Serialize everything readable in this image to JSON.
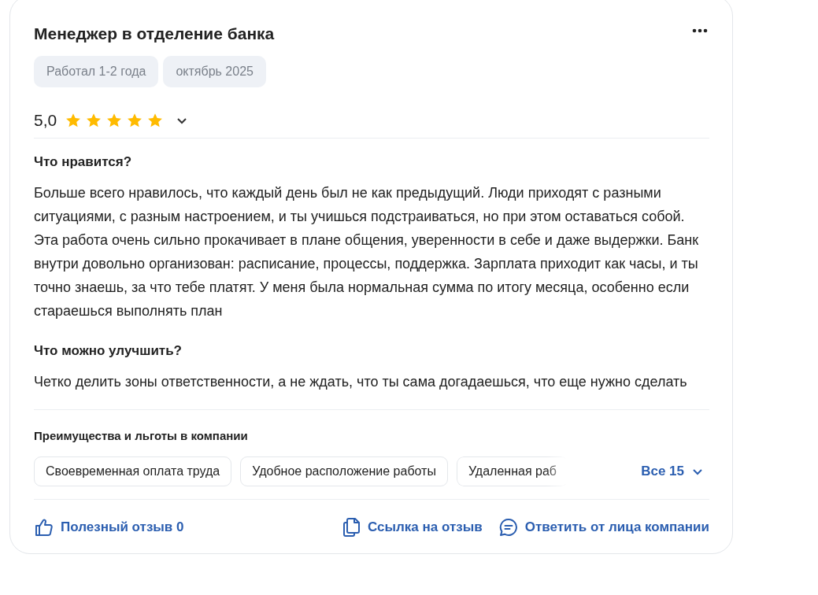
{
  "review": {
    "title": "Менеджер в отделение банка",
    "tags": [
      "Работал 1-2 года",
      "октябрь 2025"
    ],
    "rating": "5,0",
    "stars": 5,
    "sections": [
      {
        "heading": "Что нравится?",
        "text": "Больше всего нравилось, что каждый день был не как предыдущий. Люди приходят с разными ситуациями, с разным настроением, и ты учишься подстраиваться, но при этом оставаться собой. Эта работа очень сильно прокачивает в плане общения, уверенности в себе и даже выдержки. Банк внутри довольно организован: расписание, процессы, поддержка. Зарплата приходит как часы, и ты точно знаешь, за что тебе платят. У меня была нормальная сумма по итогу месяца, особенно если стараешься выполнять план"
      },
      {
        "heading": "Что можно улучшить?",
        "text": "Четко делить зоны ответственности, а не ждать, что ты сама догадаешься, что еще нужно сделать"
      }
    ],
    "benefits": {
      "heading": "Преимущества и льготы в компании",
      "items": [
        "Своевременная оплата труда",
        "Удобное расположение работы",
        "Удаленная раб"
      ],
      "more": "Все 15"
    },
    "actions": {
      "helpful": "Полезный отзыв 0",
      "link": "Ссылка на отзыв",
      "reply": "Ответить от лица компании"
    }
  }
}
